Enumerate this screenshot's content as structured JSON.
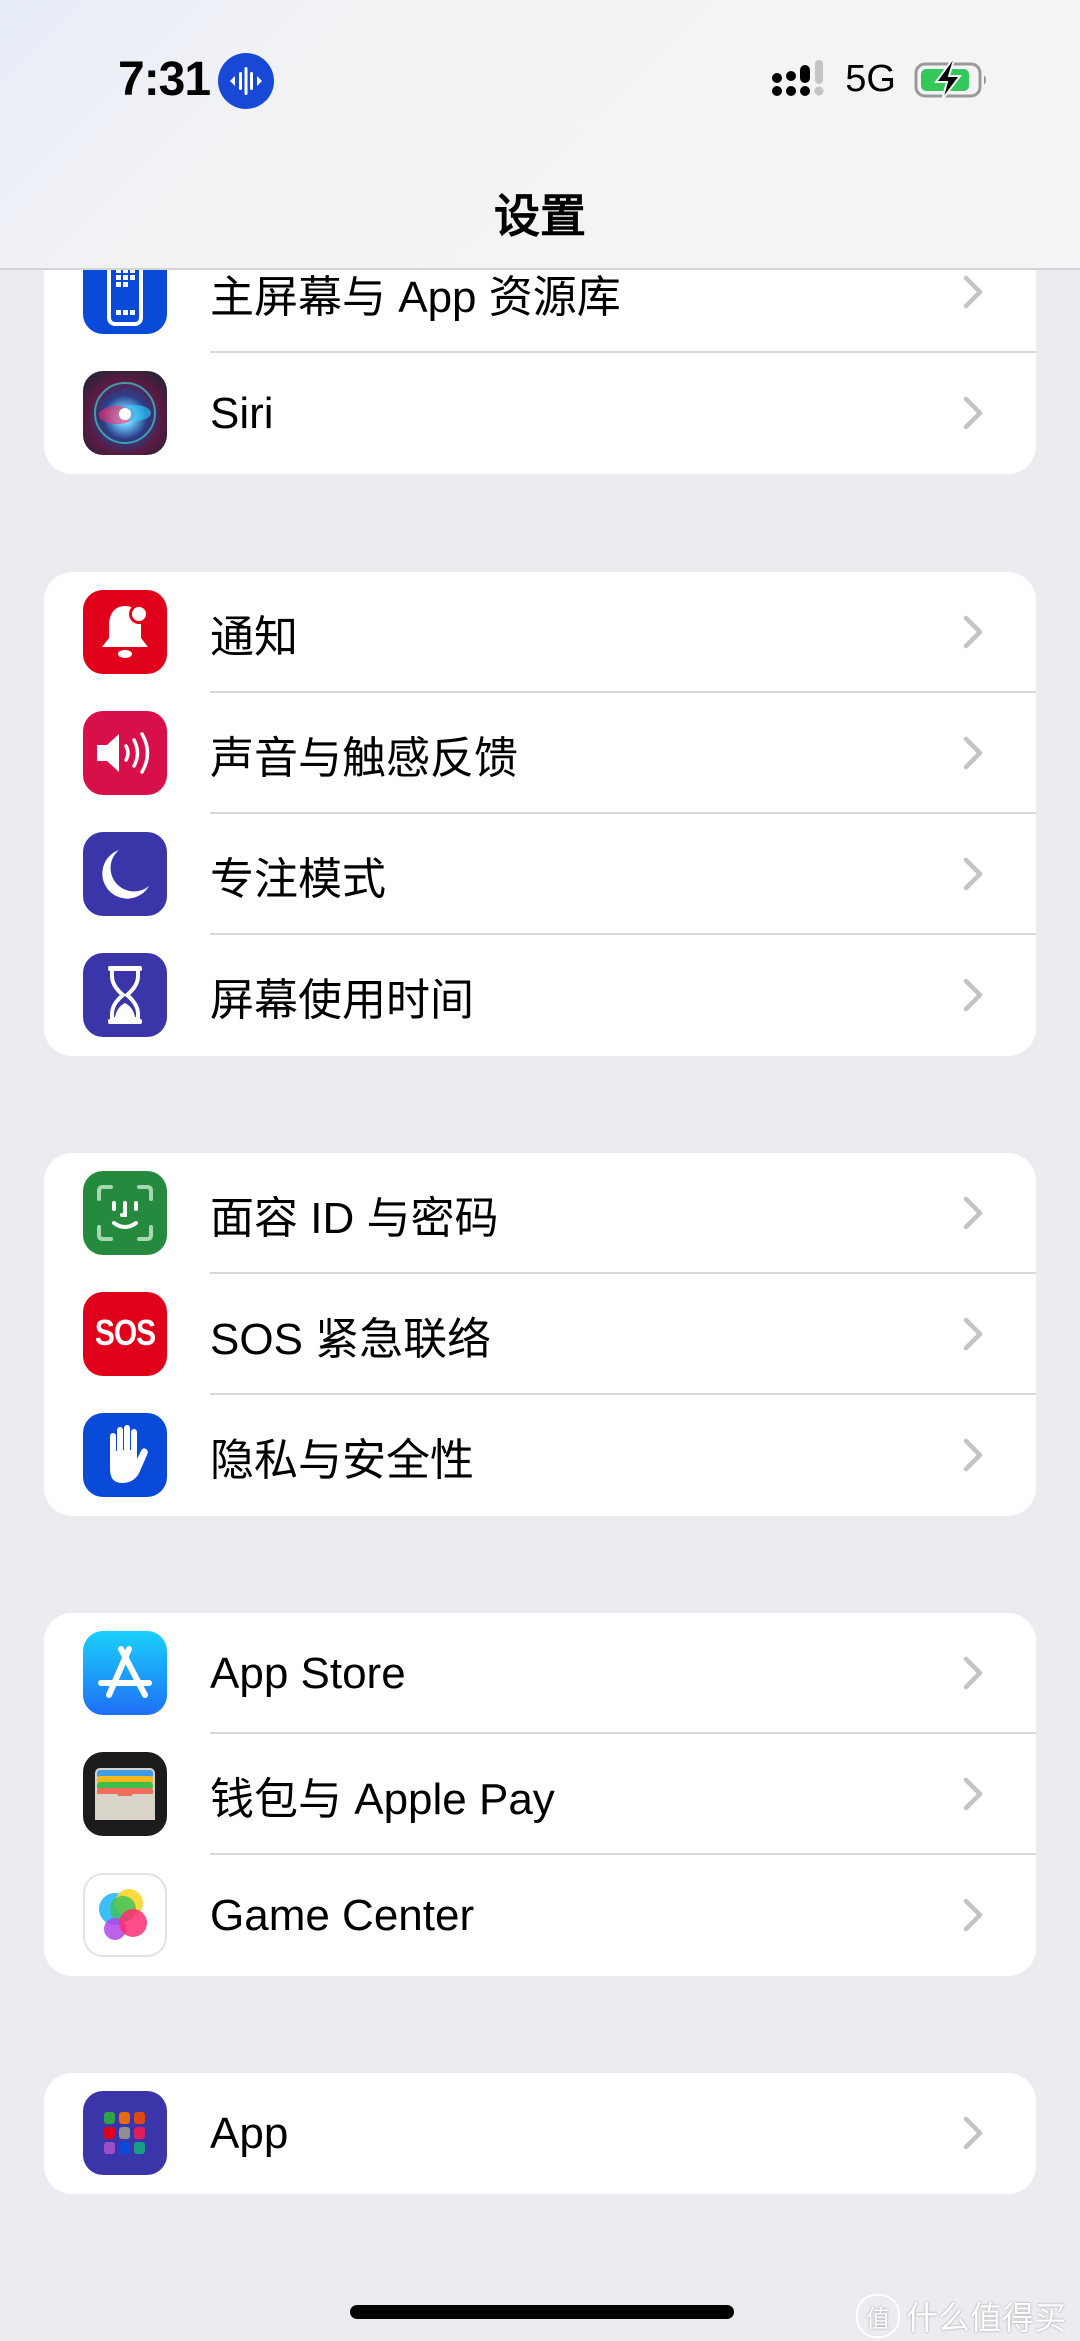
{
  "status_bar": {
    "time": "7:31",
    "network": "5G",
    "recording_icon": "audio-waveform-icon",
    "signal_icon": "cellular-signal-icon",
    "battery_icon": "battery-charging-icon",
    "battery_color": "#34c759",
    "signal_bars_active": 3,
    "signal_bars_total": 4
  },
  "header": {
    "title": "设置"
  },
  "groups": [
    {
      "items": [
        {
          "label": "主屏幕与 App 资源库",
          "icon": "home-screen-icon",
          "color": "#0a4ad9"
        },
        {
          "label": "Siri",
          "icon": "siri-icon",
          "color": "#1b1b2a"
        }
      ]
    },
    {
      "items": [
        {
          "label": "通知",
          "icon": "bell-icon",
          "color": "#e0001b"
        },
        {
          "label": "声音与触感反馈",
          "icon": "speaker-icon",
          "color": "#d7104a"
        },
        {
          "label": "专注模式",
          "icon": "moon-icon",
          "color": "#3a35a8"
        },
        {
          "label": "屏幕使用时间",
          "icon": "hourglass-icon",
          "color": "#3a35a8"
        }
      ]
    },
    {
      "items": [
        {
          "label": "面容 ID 与密码",
          "icon": "face-id-icon",
          "color": "#268a3e"
        },
        {
          "label": "SOS 紧急联络",
          "icon": "sos-icon",
          "color": "#e0001b",
          "icon_text": "SOS"
        },
        {
          "label": "隐私与安全性",
          "icon": "hand-icon",
          "color": "#0a4ad9"
        }
      ]
    },
    {
      "items": [
        {
          "label": "App Store",
          "icon": "app-store-icon",
          "color": "#1a8cff"
        },
        {
          "label": "钱包与 Apple Pay",
          "icon": "wallet-icon",
          "color": "#1c1c1e"
        },
        {
          "label": "Game Center",
          "icon": "game-center-icon",
          "color": "#ffffff"
        }
      ]
    },
    {
      "items": [
        {
          "label": "App",
          "icon": "apps-grid-icon",
          "color": "#3a35a8"
        }
      ]
    }
  ],
  "watermark": {
    "badge": "值",
    "text": "什么值得买"
  }
}
